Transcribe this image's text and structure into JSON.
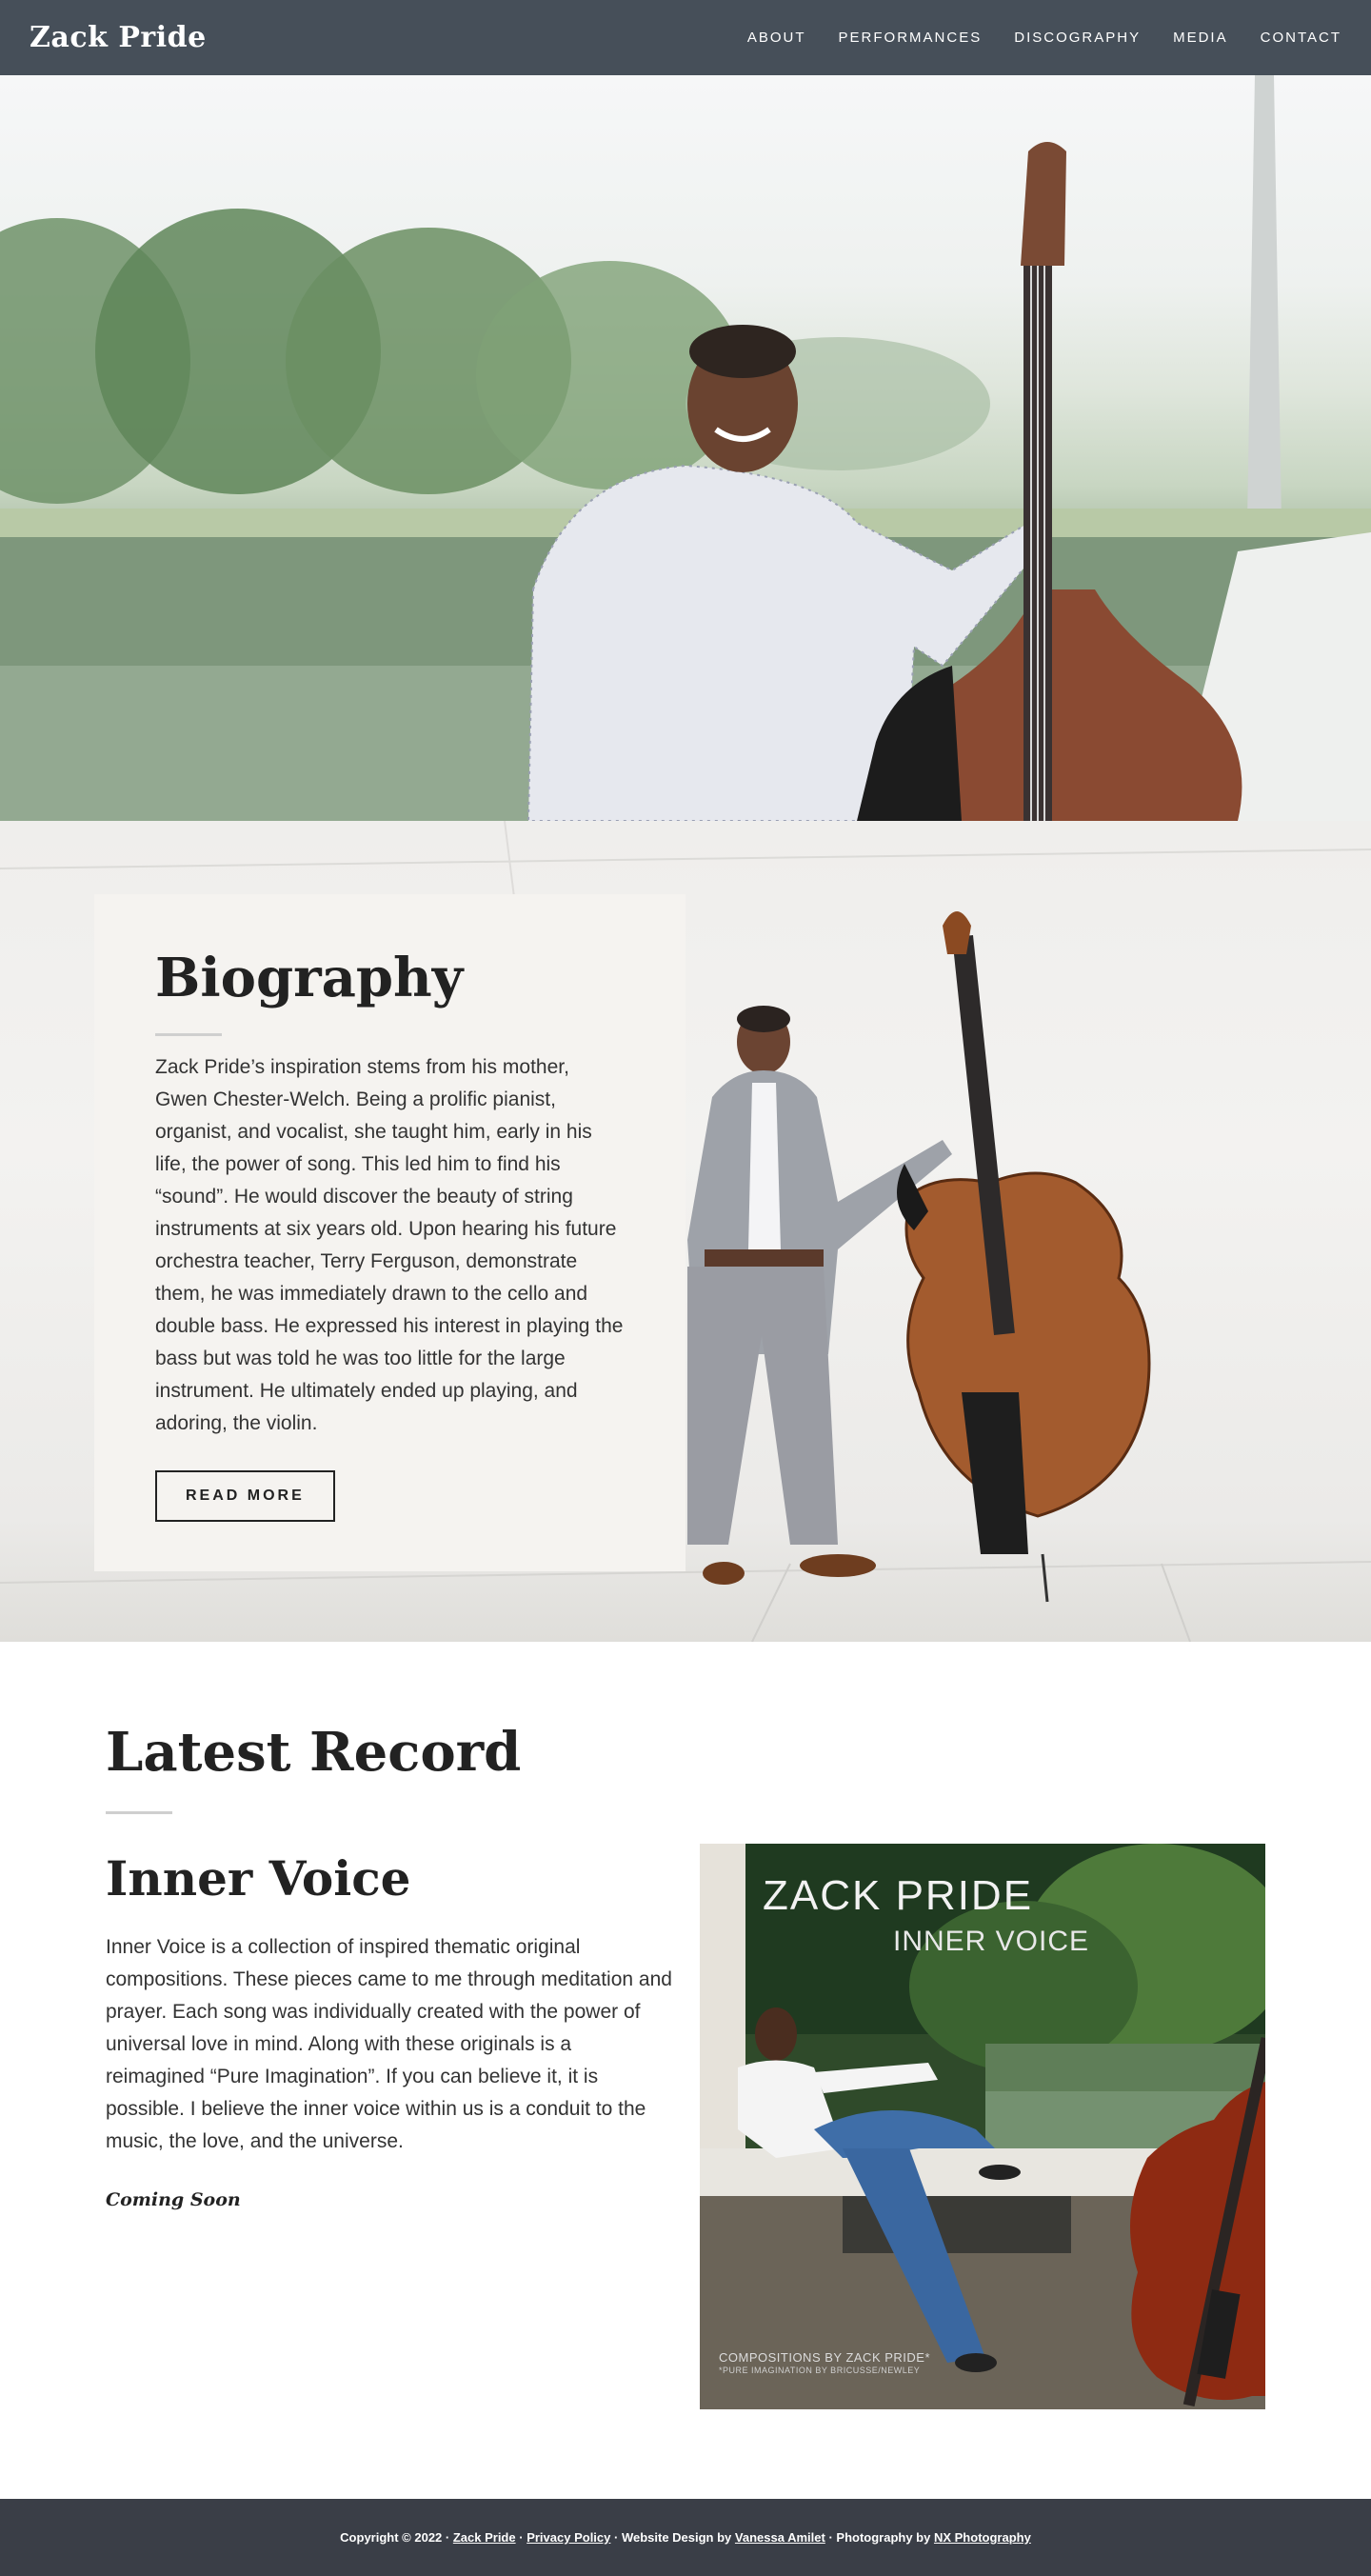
{
  "site": {
    "logo": "Zack Pride"
  },
  "nav": {
    "items": [
      {
        "label": "ABOUT"
      },
      {
        "label": "PERFORMANCES"
      },
      {
        "label": "DISCOGRAPHY"
      },
      {
        "label": "MEDIA"
      },
      {
        "label": "CONTACT"
      }
    ]
  },
  "biography": {
    "title": "Biography",
    "text": "Zack Pride’s inspiration stems from his mother, Gwen Chester-Welch. Being a prolific pianist, organist, and vocalist, she taught him, early in his life, the power of song. This led him to find his “sound”. He would discover the beauty of string instruments at six years old. Upon hearing his future orchestra teacher, Terry Ferguson, demonstrate them, he was immediately drawn to the cello and double bass. He expressed his interest in playing the bass but was told he was too little for the large instrument. He ultimately ended up playing, and adoring, the violin.",
    "button_label": "READ MORE"
  },
  "latest_record": {
    "section_title": "Latest Record",
    "album_title": "Inner Voice",
    "description": "Inner Voice is a collection of inspired thematic original compositions. These pieces came to me through meditation and prayer. Each song was individually created with the power of universal love in mind. Along with these originals is a reimagined “Pure Imagination”. If you can believe it, it is possible. I believe the inner voice within us is a conduit to the music, the love, and the universe.",
    "status": "Coming Soon",
    "cover": {
      "artist": "ZACK PRIDE",
      "album": "INNER VOICE",
      "credit": "COMPOSITIONS BY ZACK PRIDE*",
      "credit_note": "*PURE IMAGINATION BY BRICUSSE/NEWLEY"
    }
  },
  "footer": {
    "copyright": "Copyright © 2022 ·",
    "site_link": "Zack Pride",
    "sep1": "·",
    "privacy_link": "Privacy Policy",
    "design_text": "· Website Design by",
    "designer_link": "Vanessa Amilet",
    "photo_text": "· Photography by",
    "photographer_link": "NX Photography"
  },
  "colors": {
    "header_bg": "#464f59",
    "footer_bg": "#3a3e47",
    "card_bg": "#f5f3f0",
    "text": "#222222"
  }
}
